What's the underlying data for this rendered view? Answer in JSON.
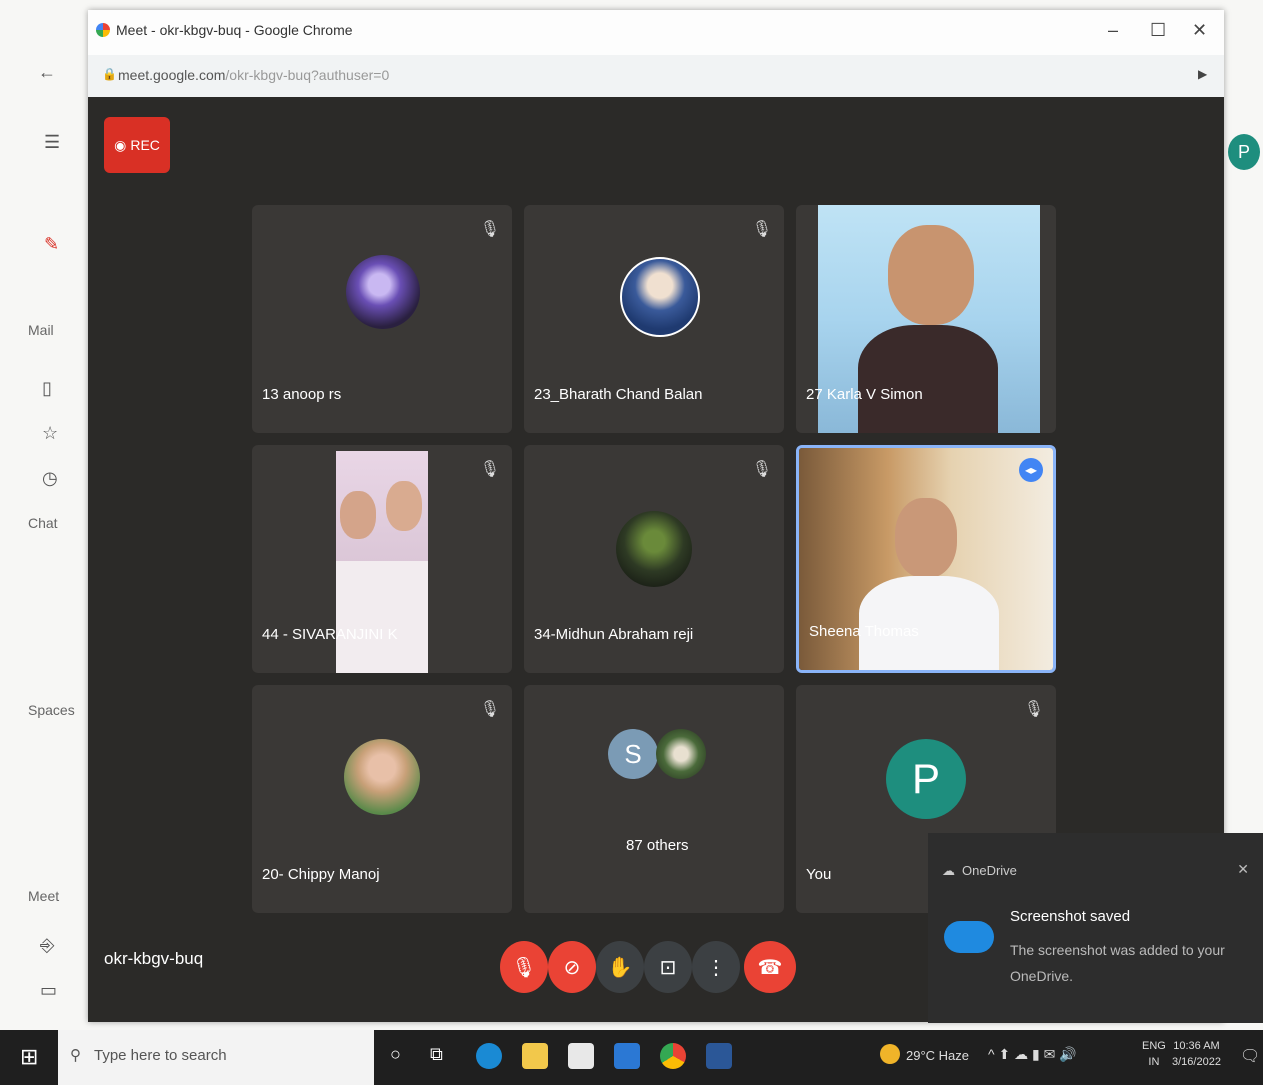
{
  "chrome": {
    "tab_title": "Meet - okr-kbgv-buq - Google Chrome",
    "url_host": "meet.google.com",
    "url_path": "/okr-kbgv-buq?authuser=0",
    "avatar_letter": "P"
  },
  "gmail": {
    "sections": [
      "Mail",
      "Chat",
      "Spaces",
      "Meet"
    ]
  },
  "meet": {
    "rec_label": "REC",
    "meeting_code": "okr-kbgv-buq",
    "participants": [
      {
        "name": "13 anoop rs"
      },
      {
        "name": "23_Bharath Chand Balan"
      },
      {
        "name": "27 Karla V Simon"
      },
      {
        "name": "44 - SIVARANJINI K"
      },
      {
        "name": "34-Midhun Abraham reji"
      },
      {
        "name": "Sheena Thomas"
      },
      {
        "name": "20- Chippy Manoj"
      },
      {
        "name": "87 others",
        "letter": "S"
      },
      {
        "name": "You",
        "letter": "P"
      }
    ]
  },
  "toast": {
    "app": "OneDrive",
    "title": "Screenshot saved",
    "body": "The screenshot was added to your OneDrive."
  },
  "taskbar": {
    "search_placeholder": "Type here to search",
    "weather": "29°C Haze",
    "lang": "ENG",
    "lang2": "IN",
    "time": "10:36 AM",
    "date": "3/16/2022"
  },
  "colors": {
    "rec_red": "#d93025",
    "end_call_red": "#ea4335",
    "you_avatar_green": "#1e8e7e",
    "others_avatar": "#7b9bb5",
    "onedrive_blue": "#1f8ae0"
  }
}
